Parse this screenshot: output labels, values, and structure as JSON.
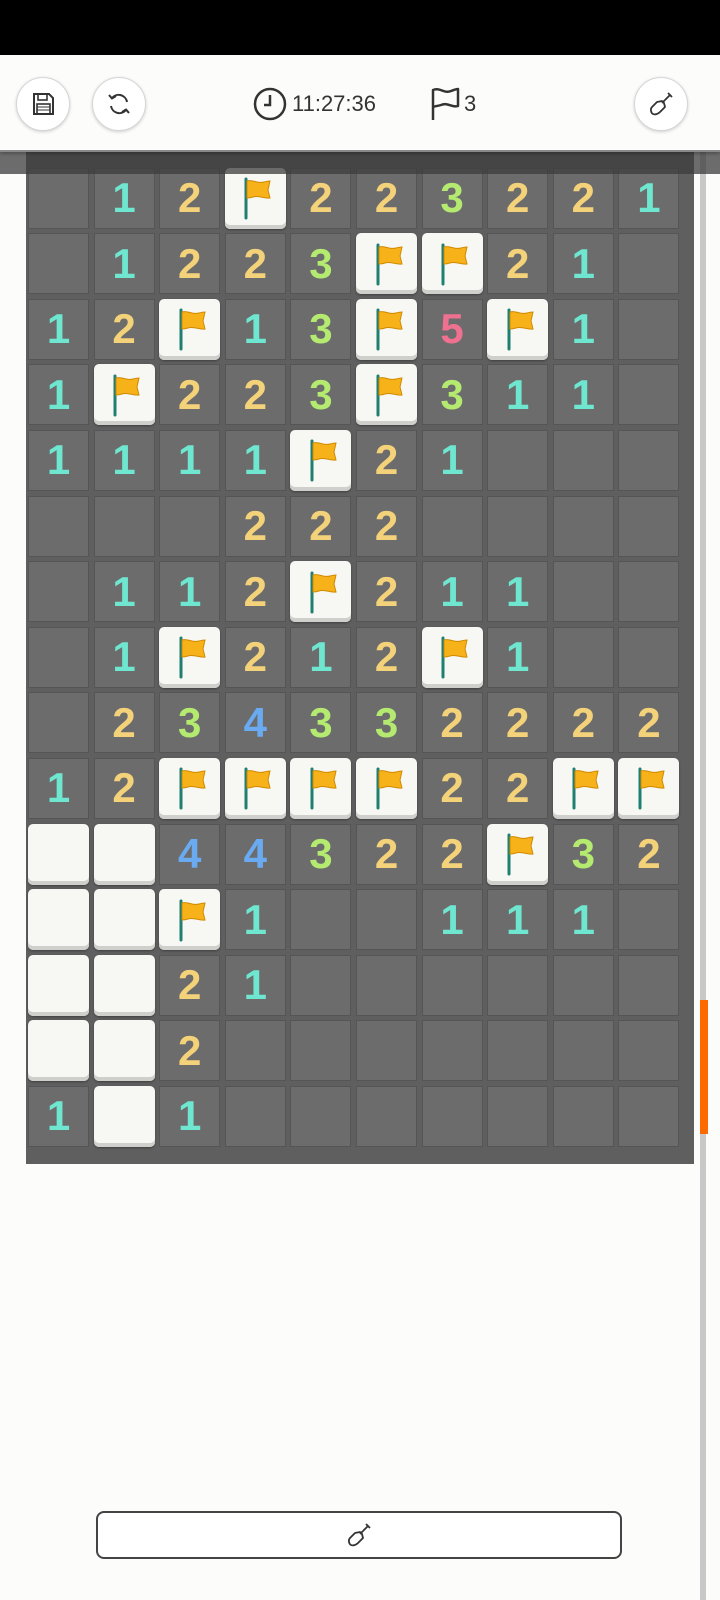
{
  "toolbar": {
    "timer": "11:27:36",
    "flag_count": "3",
    "icons": [
      "save-icon",
      "refresh-icon",
      "clock-icon",
      "flag-outline-icon",
      "shovel-icon"
    ]
  },
  "colors": {
    "n1": "#6fe6cf",
    "n2": "#f4d27a",
    "n3": "#b4ea70",
    "n4": "#6aaaf0",
    "n5": "#f0718f",
    "flag": "#f7b21a",
    "accent": "#ff6a00"
  },
  "board": {
    "cols": 10,
    "legend": "C = closed, O = open empty, F = flag, digit = revealed number",
    "rows": [
      [
        "C",
        "1",
        "2",
        "F",
        "2",
        "2",
        "3",
        "2",
        "2",
        "1"
      ],
      [
        "C",
        "1",
        "2",
        "2",
        "3",
        "F",
        "F",
        "2",
        "1",
        "C"
      ],
      [
        "1",
        "2",
        "F",
        "1",
        "3",
        "F",
        "5",
        "F",
        "1",
        "C"
      ],
      [
        "1",
        "F",
        "2",
        "2",
        "3",
        "F",
        "3",
        "1",
        "1",
        "C"
      ],
      [
        "1",
        "1",
        "1",
        "1",
        "F",
        "2",
        "1",
        "C",
        "C",
        "C"
      ],
      [
        "C",
        "C",
        "C",
        "2",
        "2",
        "2",
        "C",
        "C",
        "C",
        "C"
      ],
      [
        "C",
        "1",
        "1",
        "2",
        "F",
        "2",
        "1",
        "1",
        "C",
        "C"
      ],
      [
        "C",
        "1",
        "F",
        "2",
        "1",
        "2",
        "F",
        "1",
        "C",
        "C"
      ],
      [
        "C",
        "2",
        "3",
        "4",
        "3",
        "3",
        "2",
        "2",
        "2",
        "2"
      ],
      [
        "1",
        "2",
        "F",
        "F",
        "F",
        "F",
        "2",
        "2",
        "F",
        "F"
      ],
      [
        "O",
        "O",
        "4",
        "4",
        "3",
        "2",
        "2",
        "F",
        "3",
        "2"
      ],
      [
        "O",
        "O",
        "F",
        "1",
        "C",
        "C",
        "1",
        "1",
        "1",
        "C"
      ],
      [
        "O",
        "O",
        "2",
        "1",
        "C",
        "C",
        "C",
        "C",
        "C",
        "C"
      ],
      [
        "O",
        "O",
        "2",
        "C",
        "C",
        "C",
        "C",
        "C",
        "C",
        "C"
      ],
      [
        "1",
        "O",
        "1",
        "C",
        "C",
        "C",
        "C",
        "C",
        "C",
        "C"
      ]
    ]
  },
  "dig_button": {
    "icon": "shovel-icon"
  }
}
